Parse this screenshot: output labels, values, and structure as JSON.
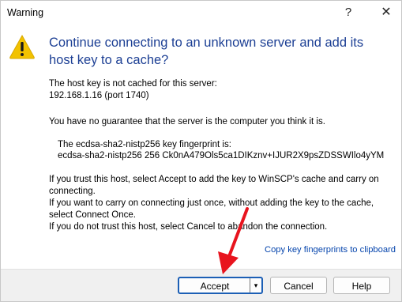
{
  "window": {
    "title": "Warning",
    "help_glyph": "?",
    "close_glyph": "✕"
  },
  "icon": {
    "name": "warning-icon",
    "color": "#f2c200",
    "symbol": "!"
  },
  "heading": "Continue connecting to an unknown server and add its host key to a cache?",
  "body": {
    "p1_line1": "The host key is not cached for this server:",
    "p1_line2": "192.168.1.16 (port 1740)",
    "p2": "You have no guarantee that the server is the computer you think it is.",
    "fp_label": "The ecdsa-sha2-nistp256 key fingerprint is:",
    "fp_value": "ecdsa-sha2-nistp256 256 Ck0nA479Ols5ca1DIKznv+IJUR2X9psZDSSWIlo4yYM",
    "instr1": "If you trust this host, select Accept to add the key to WinSCP's cache and carry on",
    "instr2": "connecting.",
    "instr3": "If you want to carry on connecting just once, without adding the key to the cache,",
    "instr4": "select Connect Once.",
    "instr5": "If you do not trust this host, select Cancel to abandon the connection."
  },
  "copy_link": "Copy key fingerprints to clipboard",
  "buttons": {
    "accept": "Accept",
    "accept_dropdown": "▾",
    "cancel": "Cancel",
    "help": "Help"
  },
  "colors": {
    "heading": "#1c3f94",
    "link": "#0645ad",
    "annotation_arrow": "#e8141e"
  }
}
